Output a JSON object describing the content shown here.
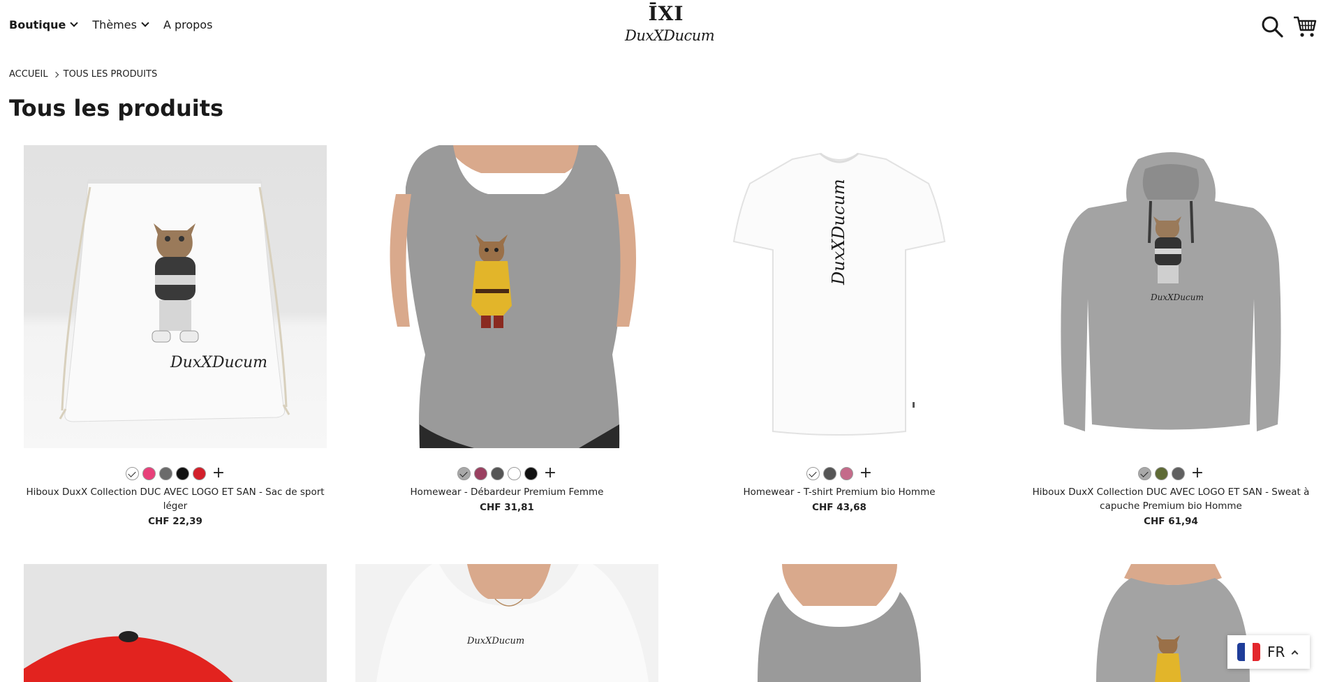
{
  "nav": {
    "items": [
      {
        "label": "Boutique",
        "dropdown": true
      },
      {
        "label": "Thèmes",
        "dropdown": true
      },
      {
        "label": "A propos",
        "dropdown": false
      }
    ]
  },
  "logo": {
    "mark": "ĪXI",
    "text": "DuxXDucum"
  },
  "breadcrumb": {
    "home": "ACCUEIL",
    "current": "TOUS LES PRODUITS"
  },
  "page_title": "Tous les produits",
  "products": [
    {
      "name": "Hiboux DuxX Collection DUC AVEC LOGO ET SAN - Sac de sport léger",
      "price": "CHF 22,39",
      "swatches": [
        "#ffffff",
        "#e8407a",
        "#6b6b6b",
        "#111111",
        "#d21f2a"
      ]
    },
    {
      "name": "Homewear - Débardeur Premium Femme",
      "price": "CHF 31,81",
      "swatches": [
        "#a8a8a8",
        "#9a4060",
        "#555555",
        "#ffffff",
        "#111111"
      ]
    },
    {
      "name": "Homewear - T-shirt Premium bio Homme",
      "price": "CHF 43,68",
      "swatches": [
        "#ffffff",
        "#555555",
        "#c46b8a"
      ]
    },
    {
      "name": "Hiboux DuxX Collection DUC AVEC LOGO ET SAN - Sweat à capuche Premium bio Homme",
      "price": "CHF 61,94",
      "swatches": [
        "#a8a8a8",
        "#5e6a35",
        "#606060"
      ]
    }
  ],
  "more_label": "+",
  "language": {
    "code": "FR"
  },
  "icons": {
    "search": "search-icon",
    "cart": "cart-icon"
  }
}
